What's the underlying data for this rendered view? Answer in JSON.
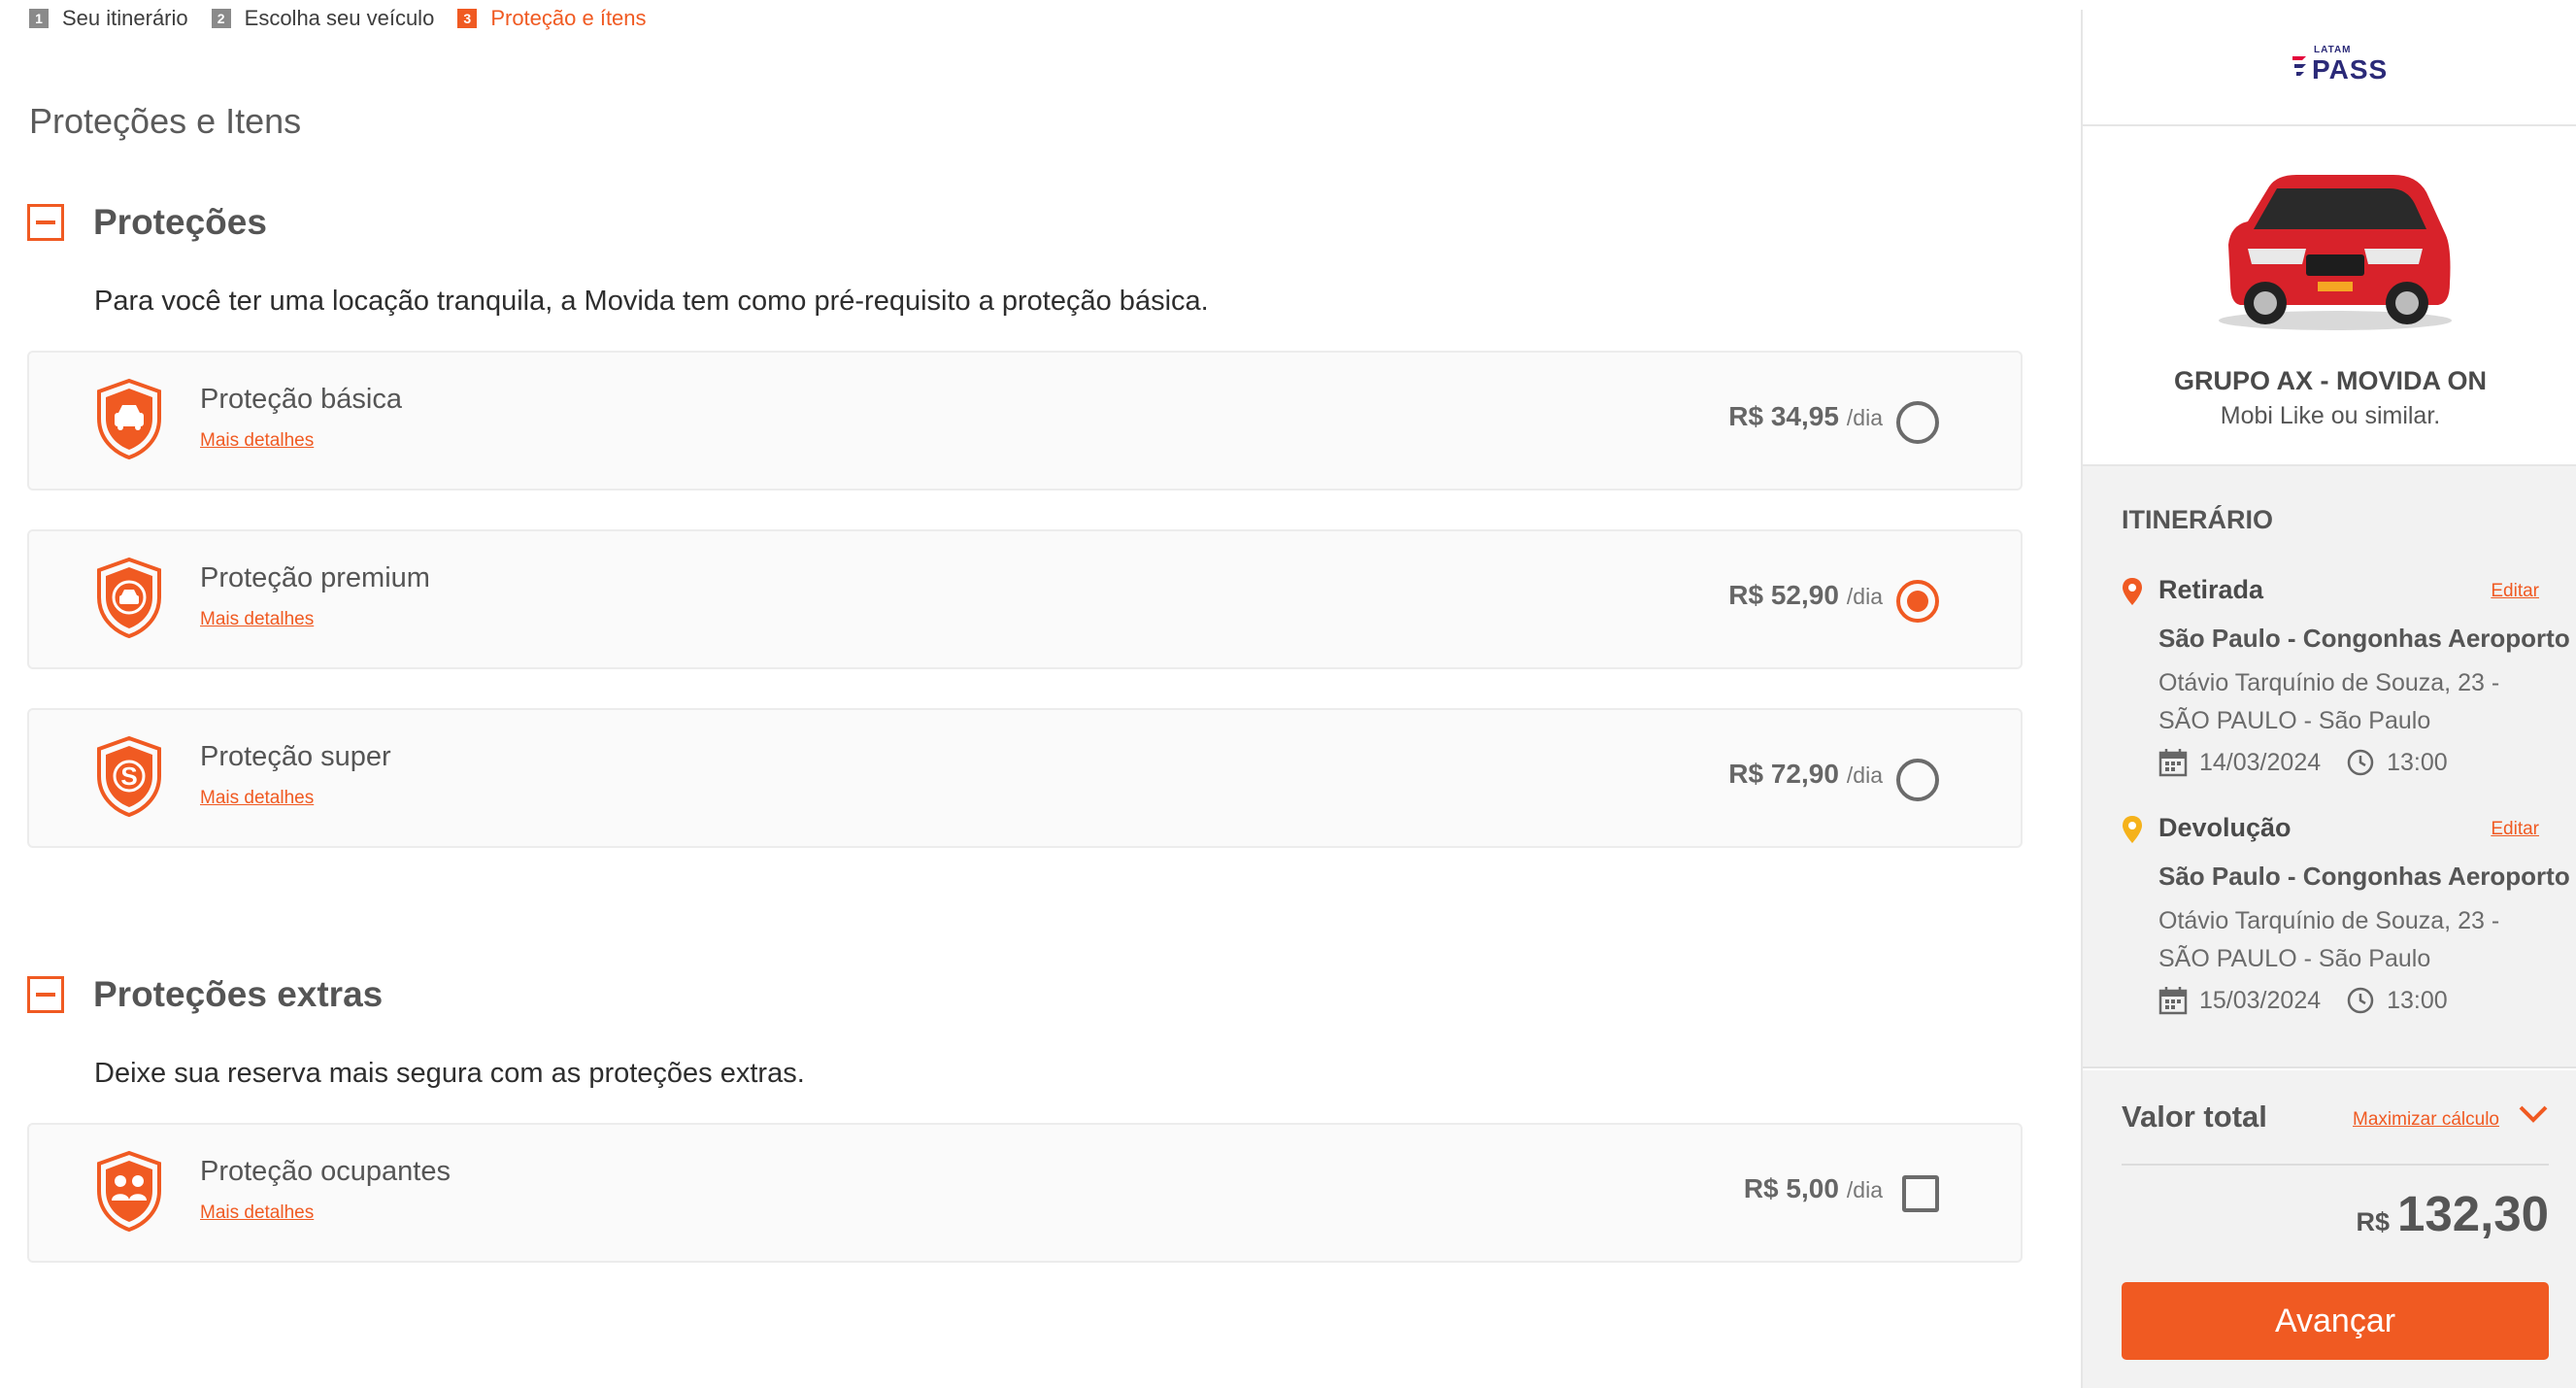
{
  "stepper": [
    {
      "num": "1",
      "label": "Seu itinerário"
    },
    {
      "num": "2",
      "label": "Escolha seu veículo"
    },
    {
      "num": "3",
      "label": "Proteção e ítens"
    }
  ],
  "page_title": "Proteções e Itens",
  "protections": {
    "title": "Proteções",
    "description": "Para você ter uma locação tranquila, a Movida tem como pré-requisito a proteção básica.",
    "items": [
      {
        "name": "Proteção básica",
        "details": "Mais detalhes",
        "price": "R$ 34,95",
        "unit": "/dia",
        "selected": false,
        "icon": "shield-car-icon"
      },
      {
        "name": "Proteção premium",
        "details": "Mais detalhes",
        "price": "R$ 52,90",
        "unit": "/dia",
        "selected": true,
        "icon": "shield-car-circle-icon"
      },
      {
        "name": "Proteção super",
        "details": "Mais detalhes",
        "price": "R$ 72,90",
        "unit": "/dia",
        "selected": false,
        "icon": "shield-s-icon"
      }
    ]
  },
  "extras": {
    "title": "Proteções extras",
    "description": "Deixe sua reserva mais segura com as proteções extras.",
    "items": [
      {
        "name": "Proteção ocupantes",
        "details": "Mais detalhes",
        "price": "R$ 5,00",
        "unit": "/dia",
        "checked": false,
        "icon": "shield-occupants-icon"
      }
    ]
  },
  "sidebar": {
    "logo": {
      "small": "LATAM",
      "big": "PASS"
    },
    "car": {
      "group": "GRUPO AX - MOVIDA ON",
      "model": "Mobi Like ou similar."
    },
    "itinerary": {
      "title": "ITINERÁRIO",
      "pickup": {
        "label": "Retirada",
        "edit": "Editar",
        "place": "São Paulo - Congonhas Aeroporto",
        "address": "Otávio Tarquínio de Souza, 23 - SÃO PAULO - São Paulo",
        "date": "14/03/2024",
        "time": "13:00"
      },
      "dropoff": {
        "label": "Devolução",
        "edit": "Editar",
        "place": "São Paulo - Congonhas Aeroporto",
        "address": "Otávio Tarquínio de Souza, 23 - SÃO PAULO - São Paulo",
        "date": "15/03/2024",
        "time": "13:00"
      }
    },
    "total": {
      "label": "Valor total",
      "maximize": "Maximizar cálculo",
      "currency": "R$",
      "amount": "132,30"
    },
    "cta": "Avançar"
  },
  "colors": {
    "accent": "#f05a22",
    "pin_pickup": "#f05a22",
    "pin_dropoff": "#f5b21b",
    "brand_latam": "#2b2a78"
  }
}
